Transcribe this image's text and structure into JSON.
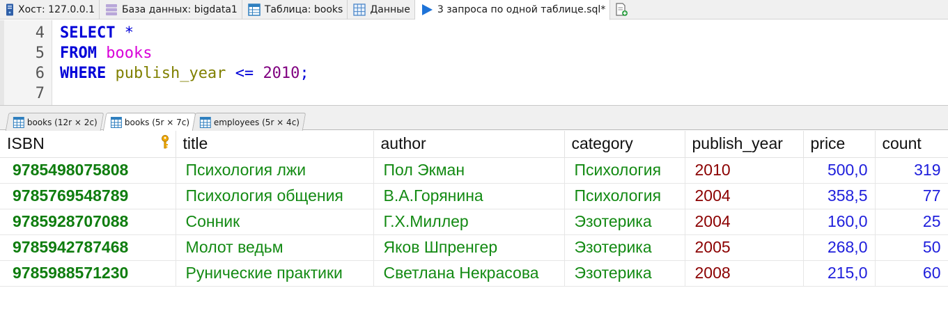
{
  "top_tabs": [
    {
      "label": "Хост: 127.0.0.1",
      "icon": "server-icon"
    },
    {
      "label": "База данных: bigdata1",
      "icon": "database-icon"
    },
    {
      "label": "Таблица: books",
      "icon": "table-icon"
    },
    {
      "label": "Данные",
      "icon": "grid-icon"
    },
    {
      "label": "3 запроса по одной таблице.sql*",
      "icon": "play-icon"
    }
  ],
  "editor": {
    "lines": [
      {
        "num": "4",
        "kw": "SELECT",
        "rest": " *"
      },
      {
        "num": "5",
        "kw": "FROM",
        "table": "books"
      },
      {
        "num": "6",
        "kw": "WHERE",
        "field": "publish_year",
        "op": "<=",
        "value": "2010",
        "end": ";"
      },
      {
        "num": "7"
      }
    ]
  },
  "result_tabs": [
    {
      "label": "books (12r × 2c)"
    },
    {
      "label": "books (5r × 7c)"
    },
    {
      "label": "employees (5r × 4c)"
    }
  ],
  "grid": {
    "columns": [
      "ISBN",
      "title",
      "author",
      "category",
      "publish_year",
      "price",
      "count"
    ],
    "rows": [
      [
        "9785498075808",
        "Психология лжи",
        "Пол Экман",
        "Психология",
        "2010",
        "500,0",
        "319"
      ],
      [
        "9785769548789",
        "Психология общения",
        "В.А.Горянина",
        "Психология",
        "2004",
        "358,5",
        "77"
      ],
      [
        "9785928707088",
        "Сонник",
        "Г.Х.Миллер",
        "Эзотерика",
        "2004",
        "160,0",
        "25"
      ],
      [
        "9785942787468",
        "Молот ведьм",
        "Яков Шпренгер",
        "Эзотерика",
        "2005",
        "268,0",
        "50"
      ],
      [
        "9785988571230",
        "Рунические практики",
        "Светлана Некрасова",
        "Эзотерика",
        "2008",
        "215,0",
        "60"
      ]
    ]
  },
  "colors": {
    "keyword": "#0000d8",
    "table_name": "#d900d9",
    "field_name": "#808000",
    "number": "#800080",
    "isbn": "#0f7d0f",
    "text_cell": "#138a13",
    "year_cell": "#8b0000",
    "numeric_cell": "#1e1edc"
  }
}
